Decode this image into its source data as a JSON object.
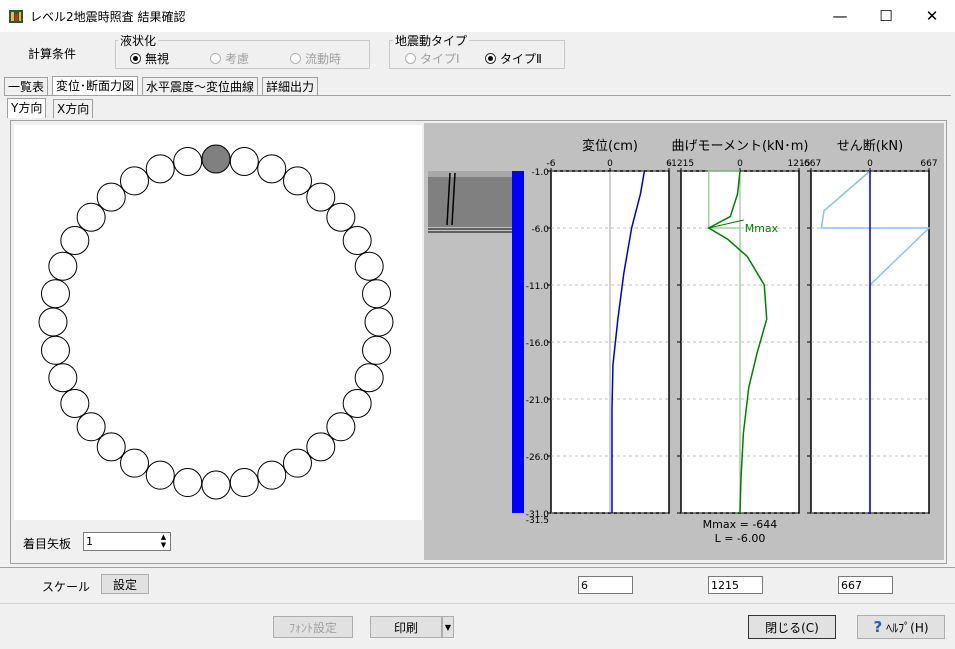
{
  "window": {
    "title": "レベル2地震時照査 結果確認",
    "minimize": "—",
    "maximize": "☐",
    "close": "✕"
  },
  "calc": {
    "label": "計算条件",
    "liquefaction": {
      "legend": "液状化",
      "options": [
        "無視",
        "考慮",
        "流動時"
      ],
      "selected": 0
    },
    "motion": {
      "legend": "地震動タイプ",
      "options": [
        "タイプⅠ",
        "タイプⅡ"
      ],
      "selected": 1
    }
  },
  "tabs": [
    "一覧表",
    "変位･断面力図",
    "水平震度～変位曲線",
    "詳細出力"
  ],
  "active_tab": 1,
  "subtabs": [
    "Y方向",
    "X方向"
  ],
  "active_subtab": 0,
  "sheet": {
    "label": "着目矢板",
    "value": "1"
  },
  "chart_data": [
    {
      "type": "line",
      "title": "変位(cm)",
      "xlim": [
        -6,
        6
      ],
      "x_ticks": [
        "-6",
        "0",
        "6"
      ],
      "ylim": [
        1.0,
        31.0
      ],
      "y_ticks": [
        "1.0",
        "6.0",
        "11.0",
        "16.0",
        "21.0",
        "26.0",
        "31.0"
      ],
      "y_end_label": "-31.5",
      "series": [
        {
          "color": "#0000cc",
          "x": [
            3.5,
            3.1,
            2.2,
            1.4,
            0.8,
            0.3,
            0.2,
            0.2,
            0.2
          ],
          "y": [
            1.0,
            3.0,
            6.0,
            10.0,
            14.0,
            18.0,
            22.0,
            26.0,
            31.0
          ]
        }
      ]
    },
    {
      "type": "line",
      "title": "曲げモーメント(kN･m)",
      "xlim": [
        -1215,
        1215
      ],
      "x_ticks": [
        "-1215",
        "0",
        "1215"
      ],
      "ylim": [
        1.0,
        31.0
      ],
      "annotation": {
        "text": "Mmax",
        "x": -644,
        "y": -6.0
      },
      "envelope": {
        "color": "#a0d0a0",
        "x": [
          0,
          -644,
          -644,
          0,
          0
        ],
        "y": [
          1.0,
          1.0,
          6.0,
          6.0,
          31.0
        ]
      },
      "series": [
        {
          "color": "#008000",
          "x": [
            0,
            -50,
            -200,
            -644,
            -250,
            150,
            500,
            550,
            350,
            180,
            70,
            20,
            0
          ],
          "y": [
            1.0,
            3.0,
            5.0,
            6.0,
            7.0,
            8.5,
            11.0,
            14.0,
            17.0,
            20.0,
            24.0,
            28.0,
            31.0
          ]
        }
      ],
      "result_lines": [
        "Mmax = -644",
        "L = -6.00"
      ]
    },
    {
      "type": "line",
      "title": "せん断(kN)",
      "xlim": [
        -667,
        667
      ],
      "x_ticks": [
        "-667",
        "0",
        "667"
      ],
      "ylim": [
        1.0,
        31.0
      ],
      "envelope": {
        "color": "#90c0f0",
        "x": [
          0,
          -520,
          -550,
          667,
          0,
          0
        ],
        "y": [
          1.0,
          4.5,
          6.0,
          6.0,
          11.0,
          31.0
        ]
      },
      "series": [
        {
          "color": "#0000cc",
          "x": [
            0,
            0
          ],
          "y": [
            1.0,
            31.0
          ]
        }
      ]
    }
  ],
  "scale": {
    "label": "スケール",
    "button": "設定",
    "values": [
      "6",
      "1215",
      "667"
    ]
  },
  "footer": {
    "font_button": "ﾌｫﾝﾄ設定",
    "print_button": "印刷",
    "close_button": "閉じる(C)",
    "help_button": "ﾍﾙﾌﾟ(H)",
    "help_mark": "?"
  },
  "colors": {
    "selected_pile": "#808080",
    "depth_bar": "#0000ff",
    "plot_bg": "#c0c0c0"
  }
}
